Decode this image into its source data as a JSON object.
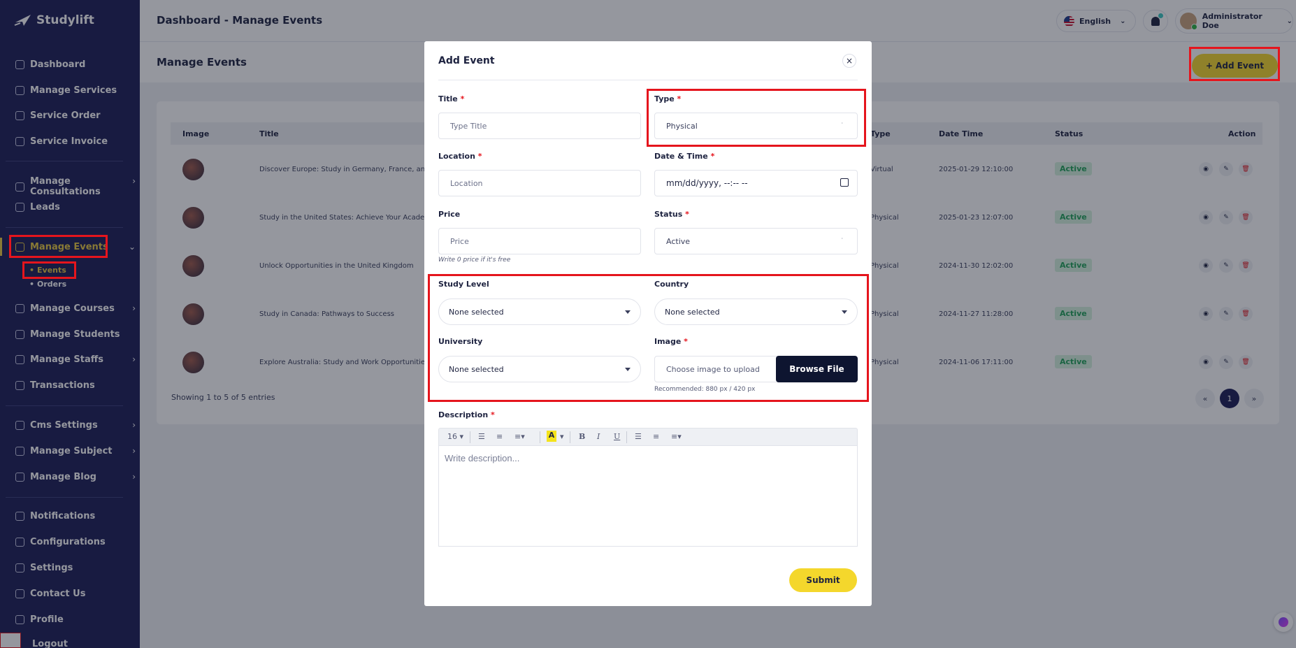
{
  "brand": {
    "name": "Studylift"
  },
  "colors": {
    "sidebar": "#1c1e57",
    "accent": "#f4d72c",
    "active_nav": "#e8c840",
    "highlight_box": "#e5151d",
    "badge_bg": "#d6f3df",
    "badge_text": "#21a35a",
    "dark_button": "#0e1530"
  },
  "sidebar": {
    "items": [
      {
        "label": "Dashboard",
        "icon": "grid-icon"
      },
      {
        "label": "Manage Services",
        "icon": "gear-icon"
      },
      {
        "label": "Service Order",
        "icon": "list-icon"
      },
      {
        "label": "Service Invoice",
        "icon": "invoice-icon"
      },
      {
        "label": "Manage Consultations",
        "icon": "chat-icon"
      },
      {
        "label": "Leads",
        "icon": "leads-icon"
      },
      {
        "label": "Manage Events",
        "icon": "calendar-icon"
      },
      {
        "label": "Manage Courses",
        "icon": "book-icon"
      },
      {
        "label": "Manage Students",
        "icon": "student-icon"
      },
      {
        "label": "Manage Staffs",
        "icon": "staff-icon"
      },
      {
        "label": "Transactions",
        "icon": "money-icon"
      },
      {
        "label": "Cms Settings",
        "icon": "cms-icon"
      },
      {
        "label": "Manage Subject",
        "icon": "subject-icon"
      },
      {
        "label": "Manage Blog",
        "icon": "blog-icon"
      },
      {
        "label": "Notifications",
        "icon": "bell-icon"
      },
      {
        "label": "Configurations",
        "icon": "config-icon"
      },
      {
        "label": "Settings",
        "icon": "settings-icon"
      },
      {
        "label": "Contact Us",
        "icon": "contact-icon"
      },
      {
        "label": "Profile",
        "icon": "user-icon"
      },
      {
        "label": "Logout",
        "icon": "logout-icon"
      }
    ],
    "sub_items": [
      "Events",
      "Orders"
    ]
  },
  "header": {
    "breadcrumb_root": "Dashboard",
    "breadcrumb_sep": "-",
    "breadcrumb_current": "Manage Events",
    "language": "English",
    "user_name": "Administrator Doe"
  },
  "page": {
    "title": "Manage Events",
    "add_button": "+ Add Event",
    "table_headers": [
      "Image",
      "Title",
      "Type",
      "Date Time",
      "Status",
      "Action"
    ],
    "rows": [
      {
        "title": "Discover Europe: Study in Germany, France, and t",
        "type": "Virtual",
        "datetime": "2025-01-29 12:10:00",
        "status": "Active"
      },
      {
        "title": "Study in the United States: Achieve Your Academ",
        "type": "Physical",
        "datetime": "2025-01-23 12:07:00",
        "status": "Active"
      },
      {
        "title": "Unlock Opportunities in the United Kingdom",
        "type": "Physical",
        "datetime": "2024-11-30 12:02:00",
        "status": "Active"
      },
      {
        "title": "Study in Canada: Pathways to Success",
        "type": "Physical",
        "datetime": "2024-11-27 11:28:00",
        "status": "Active"
      },
      {
        "title": "Explore Australia: Study and Work Opportunities",
        "type": "Physical",
        "datetime": "2024-11-06 17:11:00",
        "status": "Active"
      }
    ],
    "showing": "Showing 1 to 5 of 5 entries",
    "pagination": {
      "prev": "«",
      "current": "1",
      "next": "»"
    }
  },
  "modal": {
    "title": "Add Event",
    "close": "×",
    "required_mark": "*",
    "fields": {
      "title_label": "Title",
      "title_placeholder": "Type Title",
      "type_label": "Type",
      "type_value": "Physical",
      "location_label": "Location",
      "location_placeholder": "Location",
      "datetime_label": "Date & Time",
      "datetime_value": "mm/dd/yyyy, --:-- --",
      "price_label": "Price",
      "price_placeholder": "Price",
      "price_hint": "Write 0 price if it's free",
      "status_label": "Status",
      "status_value": "Active",
      "study_level_label": "Study Level",
      "study_level_value": "None selected",
      "country_label": "Country",
      "country_value": "None selected",
      "university_label": "University",
      "university_value": "None selected",
      "image_label": "Image",
      "image_placeholder": "Choose image to upload",
      "browse_label": "Browse File",
      "image_hint": "Recommended: 880 px / 420 px",
      "description_label": "Description",
      "description_placeholder": "Write description..."
    },
    "toolbar": {
      "font_size": "16",
      "highlight": "A",
      "bold": "B",
      "italic": "I",
      "underline": "U"
    },
    "submit": "Submit"
  }
}
